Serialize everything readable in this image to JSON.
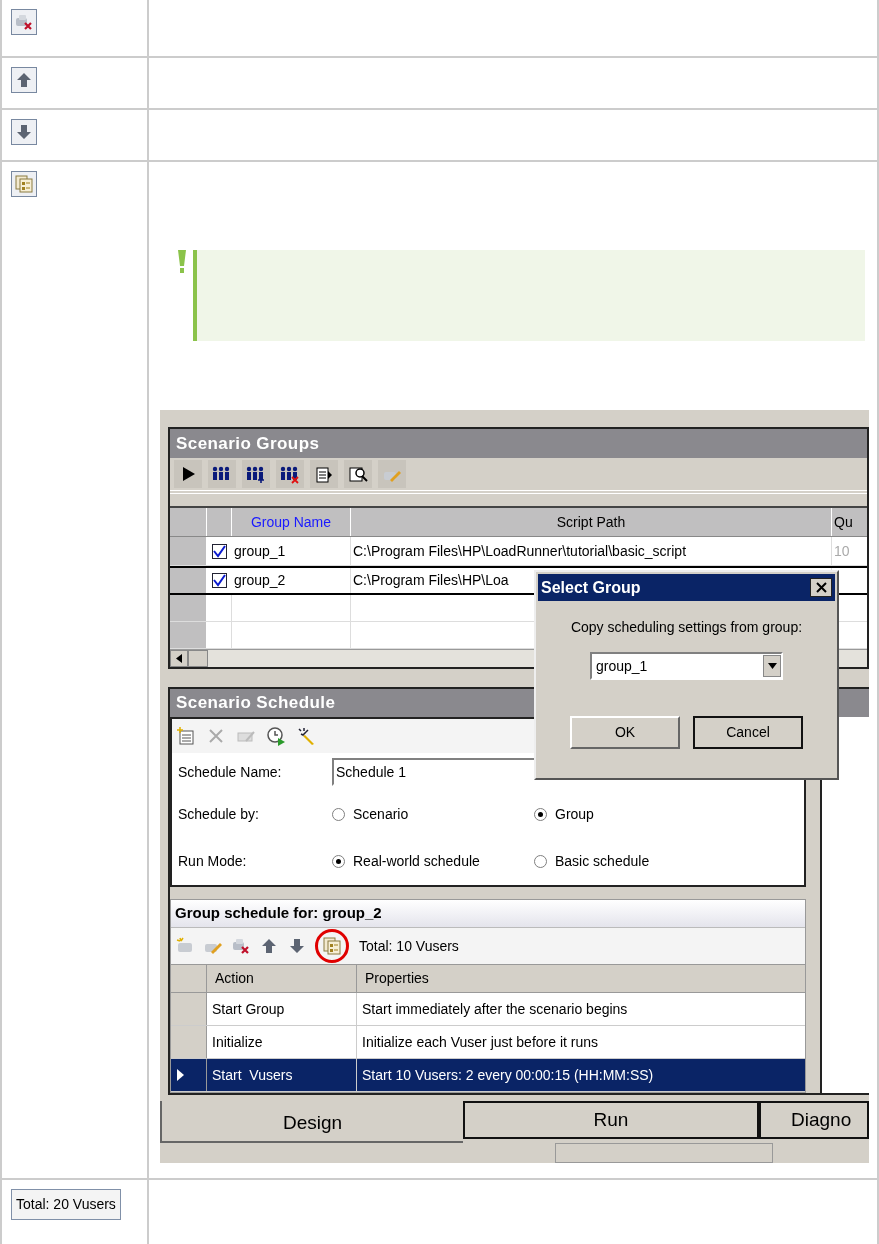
{
  "table": {
    "rows": [
      {
        "kind": "delete"
      },
      {
        "kind": "up"
      },
      {
        "kind": "down"
      },
      {
        "kind": "copy",
        "note": {
          "kind": "important"
        },
        "screenshot": {
          "groups_panel": {
            "title": "Scenario Groups",
            "columns": [
              "Group Name",
              "Script Path",
              "Qu"
            ],
            "rows": [
              {
                "checked": true,
                "name": "group_1",
                "path": "C:\\Program Files\\HP\\LoadRunner\\tutorial\\basic_script",
                "quantity": "10",
                "selected": false
              },
              {
                "checked": true,
                "name": "group_2",
                "path": "C:\\Program Files\\HP\\Loa",
                "selected": true
              }
            ]
          },
          "schedule_panel": {
            "title": "Scenario Schedule",
            "name_label": "Schedule Name:",
            "name_value": "Schedule 1",
            "options": [
              {
                "label": "Schedule by:",
                "choices": [
                  {
                    "label": "Scenario",
                    "selected": false
                  },
                  {
                    "label": "Group",
                    "selected": true
                  }
                ]
              },
              {
                "label": "Run Mode:",
                "choices": [
                  {
                    "label": "Real-world schedule",
                    "selected": true
                  },
                  {
                    "label": "Basic schedule",
                    "selected": false
                  }
                ]
              }
            ]
          },
          "group_schedule": {
            "title": "Group schedule for: group_2",
            "toolbar": [
              {
                "highlighted": false
              },
              {
                "highlighted": false
              },
              {
                "highlighted": false
              },
              {
                "highlighted": false
              },
              {
                "highlighted": false
              },
              {
                "highlighted": true
              }
            ],
            "total": "Total: 10 Vusers",
            "columns": [
              "Action",
              "Properties"
            ],
            "rows": [
              {
                "action": "Start Group",
                "properties": "Start immediately after the scenario begins",
                "selected": false
              },
              {
                "action": "Initialize",
                "properties": "Initialize each Vuser just before it runs",
                "selected": false
              },
              {
                "action": "Start  Vusers",
                "properties": "Start 10 Vusers: 2 every 00:00:15 (HH:MM:SS)",
                "selected": true
              }
            ]
          },
          "tabs": [
            {
              "label": "Design",
              "selected": true
            },
            {
              "label": "Run",
              "selected": false
            },
            {
              "label": "Diagno",
              "selected": false
            }
          ],
          "dialog": {
            "title": "Select Group",
            "prompt": "Copy scheduling settings from group:",
            "value": "group_1",
            "buttons": [
              "OK",
              "Cancel"
            ]
          }
        }
      },
      {
        "kind": "total",
        "label": "Total: 20 Vusers"
      }
    ]
  }
}
